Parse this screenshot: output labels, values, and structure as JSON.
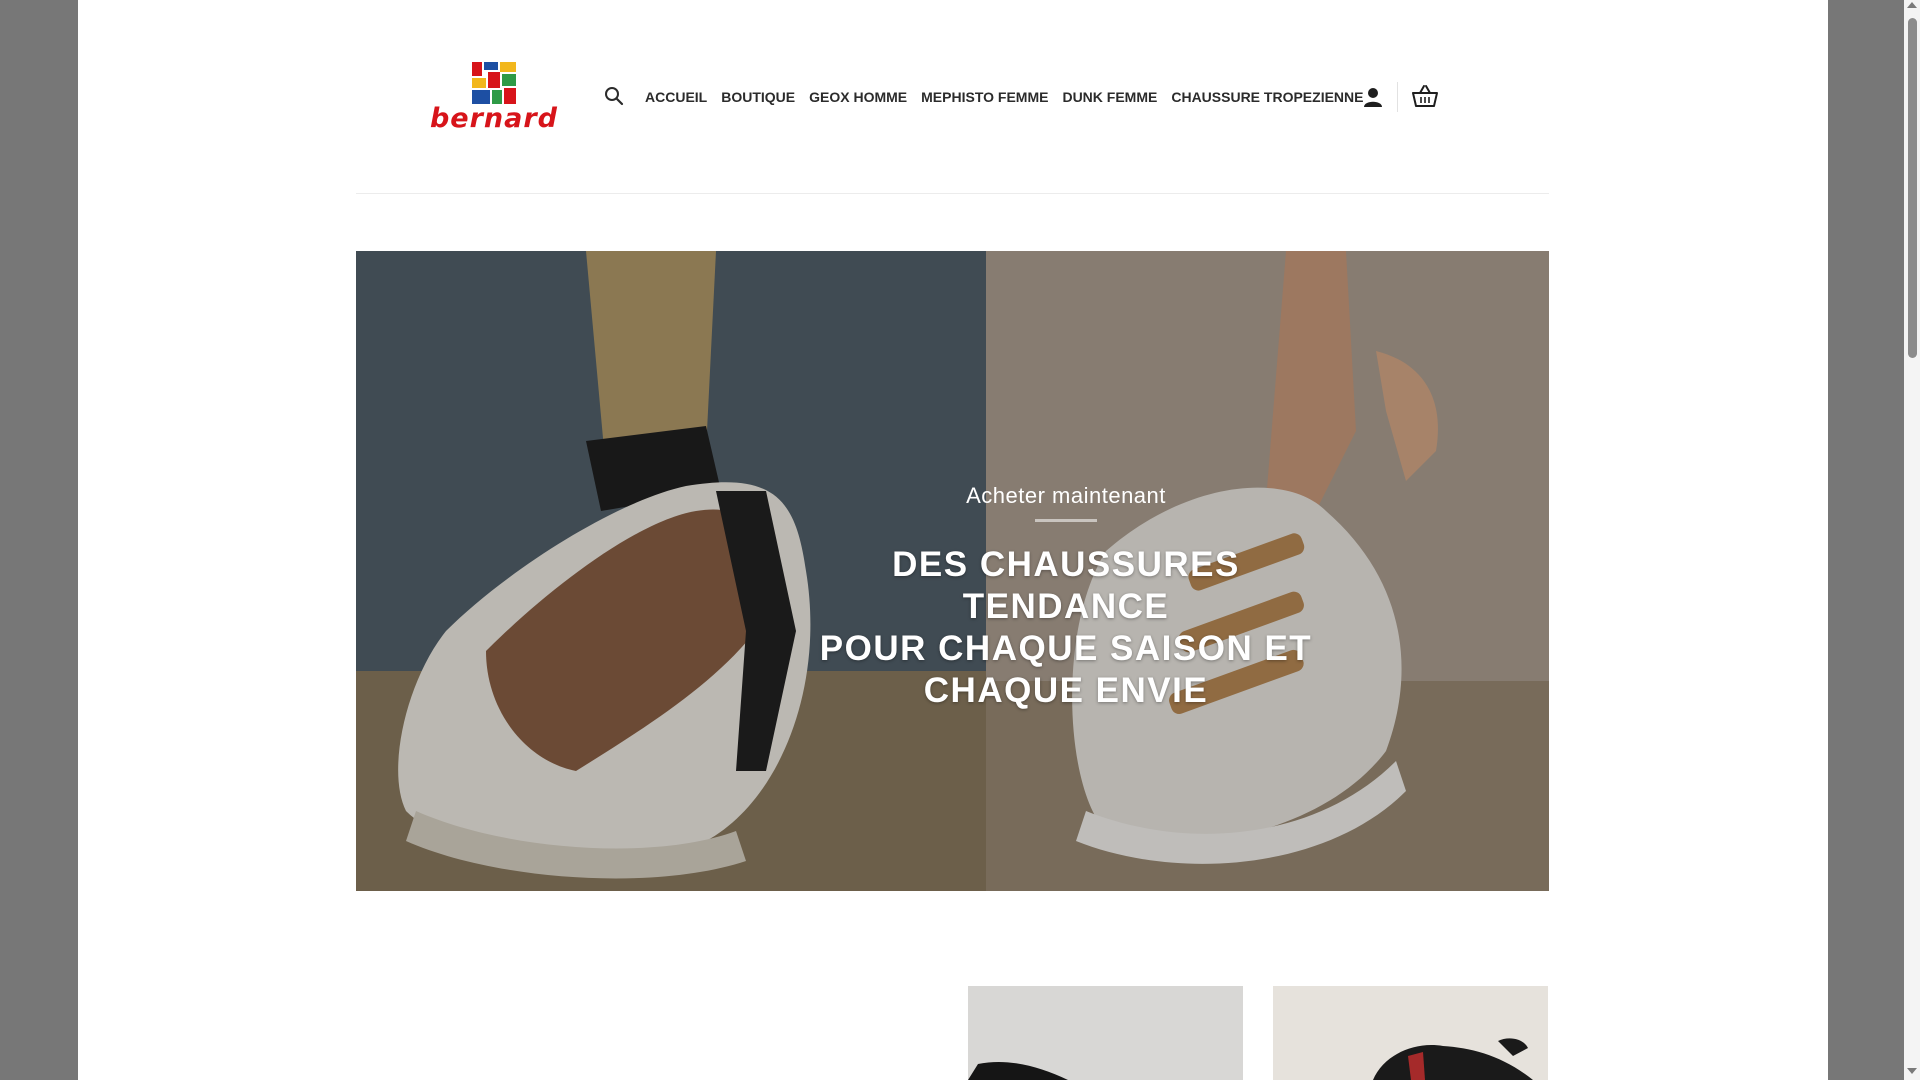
{
  "brand": {
    "logo_text": "bernard",
    "colors": {
      "logo_red": "#d7141a",
      "logo_blue": "#1d4fa3",
      "logo_yellow": "#f2b71c",
      "logo_green": "#2e9a46"
    }
  },
  "header": {
    "search_icon": "search-icon",
    "nav": [
      {
        "label": "ACCUEIL"
      },
      {
        "label": "BOUTIQUE"
      },
      {
        "label": "GEOX HOMME"
      },
      {
        "label": "MEPHISTO FEMME"
      },
      {
        "label": "DUNK FEMME"
      },
      {
        "label": "CHAUSSURE TROPEZIENNE"
      }
    ],
    "account_icon": "user-icon",
    "cart_icon": "basket-icon"
  },
  "hero": {
    "kicker": "Acheter maintenant",
    "title_line1": "DES CHAUSSURES TENDANCE",
    "title_line2": "POUR CHAQUE SAISON ET",
    "title_line3": "CHAQUE ENVIE"
  },
  "products": [
    {
      "name": "product-1",
      "image": "black-shoe-image"
    },
    {
      "name": "product-2",
      "image": "black-sneaker-image"
    }
  ]
}
